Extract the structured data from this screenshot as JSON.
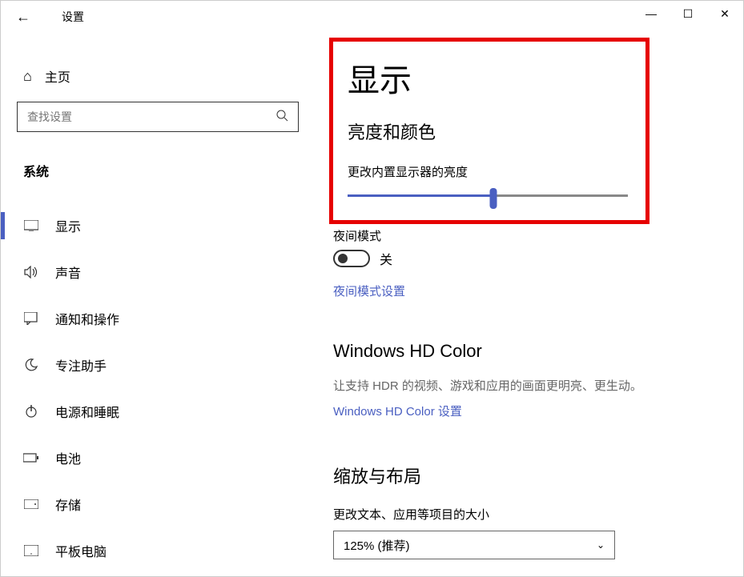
{
  "window": {
    "title": "设置",
    "back_icon": "←",
    "min_icon": "—",
    "max_icon": "☐",
    "close_icon": "✕"
  },
  "sidebar": {
    "home_icon": "⌂",
    "home_label": "主页",
    "search_placeholder": "查找设置",
    "search_icon": "🔍",
    "category_label": "系统",
    "items": [
      {
        "icon": "🖵",
        "label": "显示",
        "active": true
      },
      {
        "icon": "🔊",
        "label": "声音",
        "active": false
      },
      {
        "icon": "💬",
        "label": "通知和操作",
        "active": false
      },
      {
        "icon": "☽",
        "label": "专注助手",
        "active": false
      },
      {
        "icon": "⏻",
        "label": "电源和睡眠",
        "active": false
      },
      {
        "icon": "▭",
        "label": "电池",
        "active": false
      },
      {
        "icon": "▭",
        "label": "存储",
        "active": false
      },
      {
        "icon": "▭",
        "label": "平板电脑",
        "active": false
      }
    ]
  },
  "content": {
    "page_title": "显示",
    "brightness_section": "亮度和颜色",
    "brightness_label": "更改内置显示器的亮度",
    "brightness_value": 52,
    "nightmode_label": "夜间模式",
    "toggle_state": "关",
    "nightmode_link": "夜间模式设置",
    "hd_title": "Windows HD Color",
    "hd_desc": "让支持 HDR 的视频、游戏和应用的画面更明亮、更生动。",
    "hd_link": "Windows HD Color 设置",
    "scale_title": "缩放与布局",
    "scale_label": "更改文本、应用等项目的大小",
    "scale_value": "125% (推荐)",
    "chevron": "⌄"
  }
}
